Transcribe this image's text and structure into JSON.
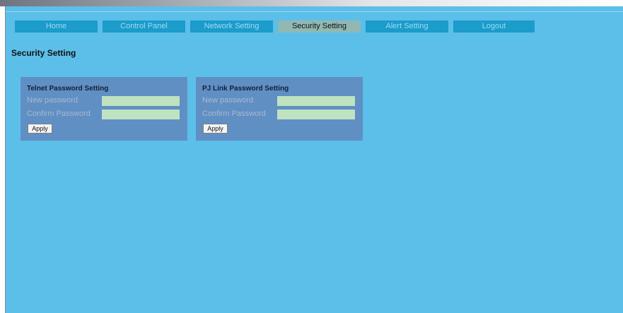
{
  "nav": {
    "tabs": [
      {
        "label": "Home"
      },
      {
        "label": "Control Panel"
      },
      {
        "label": "Network Setting"
      },
      {
        "label": "Security Setting",
        "active": true
      },
      {
        "label": "Alert Setting"
      },
      {
        "label": "Logout"
      }
    ]
  },
  "page": {
    "title": "Security Setting"
  },
  "telnet": {
    "title": "Telnet Password Setting",
    "new_label": "New password",
    "new_value": "",
    "confirm_label": "Confirm Password",
    "confirm_value": "",
    "apply_label": "Apply"
  },
  "pjlink": {
    "title": "PJ Link Password Setting",
    "new_label": "New password",
    "new_value": "",
    "confirm_label": "Confirm Password",
    "confirm_value": "",
    "apply_label": "Apply"
  },
  "colors": {
    "background": "#5cbfe9",
    "tab_bg": "#1b9ccb",
    "tab_text": "#9fdaf5",
    "tab_active_bg": "#91b8b2",
    "panel_bg": "#608fc4",
    "input_bg": "#bfe2c0"
  }
}
